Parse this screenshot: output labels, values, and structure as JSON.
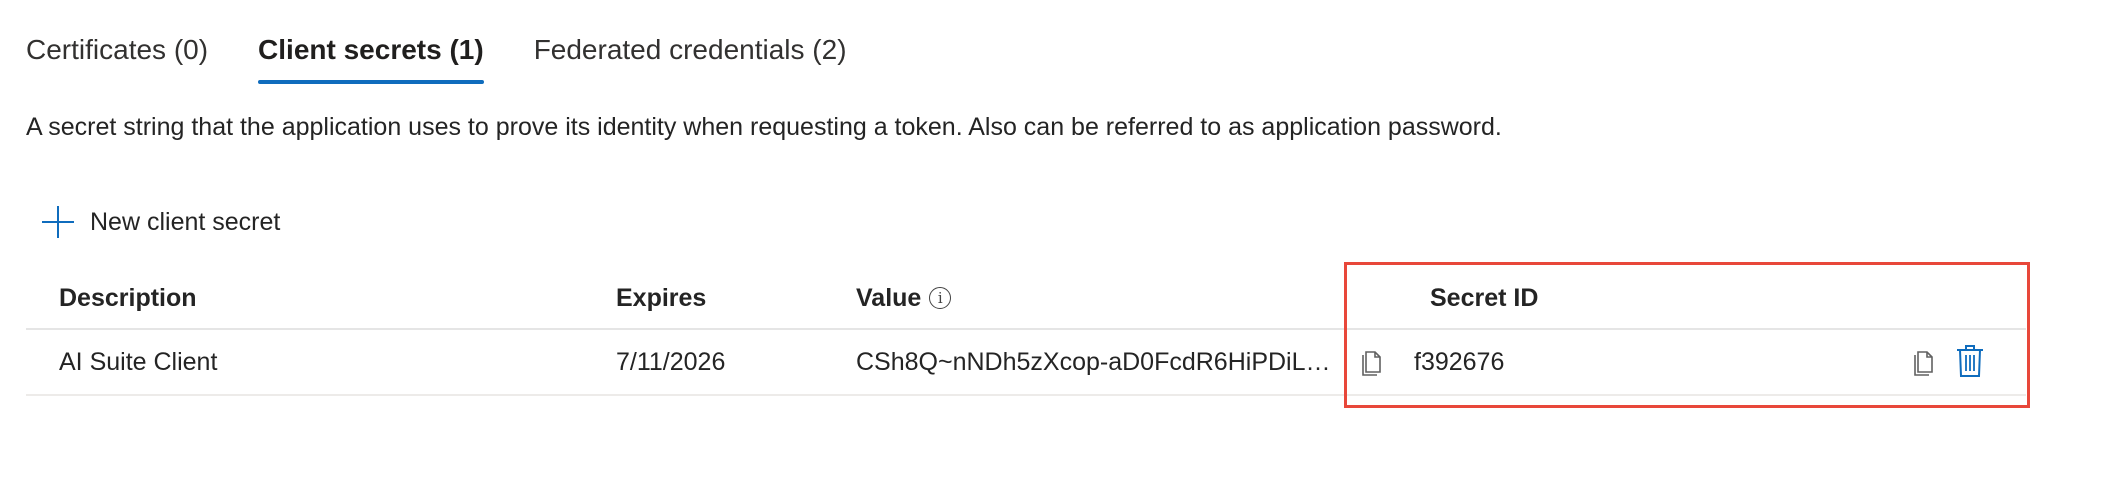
{
  "tabs": [
    {
      "label": "Certificates (0)",
      "active": false
    },
    {
      "label": "Client secrets (1)",
      "active": true
    },
    {
      "label": "Federated credentials (2)",
      "active": false
    }
  ],
  "description": "A secret string that the application uses to prove its identity when requesting a token. Also can be referred to as application password.",
  "toolbar": {
    "new_secret_label": "New client secret",
    "new_secret_icon": "plus-icon"
  },
  "table": {
    "headers": {
      "description": "Description",
      "expires": "Expires",
      "value": "Value",
      "value_info_icon": "info-icon",
      "secret_id": "Secret ID"
    },
    "rows": [
      {
        "description": "AI Suite Client",
        "expires": "7/11/2026",
        "value": "CSh8Q~nNDh5zXcop-aD0FcdR6HiPDiL2...",
        "secret_id": "f392676"
      }
    ]
  },
  "colors": {
    "accent": "#0f6cbd",
    "highlight": "#e8473a",
    "text": "#242424"
  }
}
